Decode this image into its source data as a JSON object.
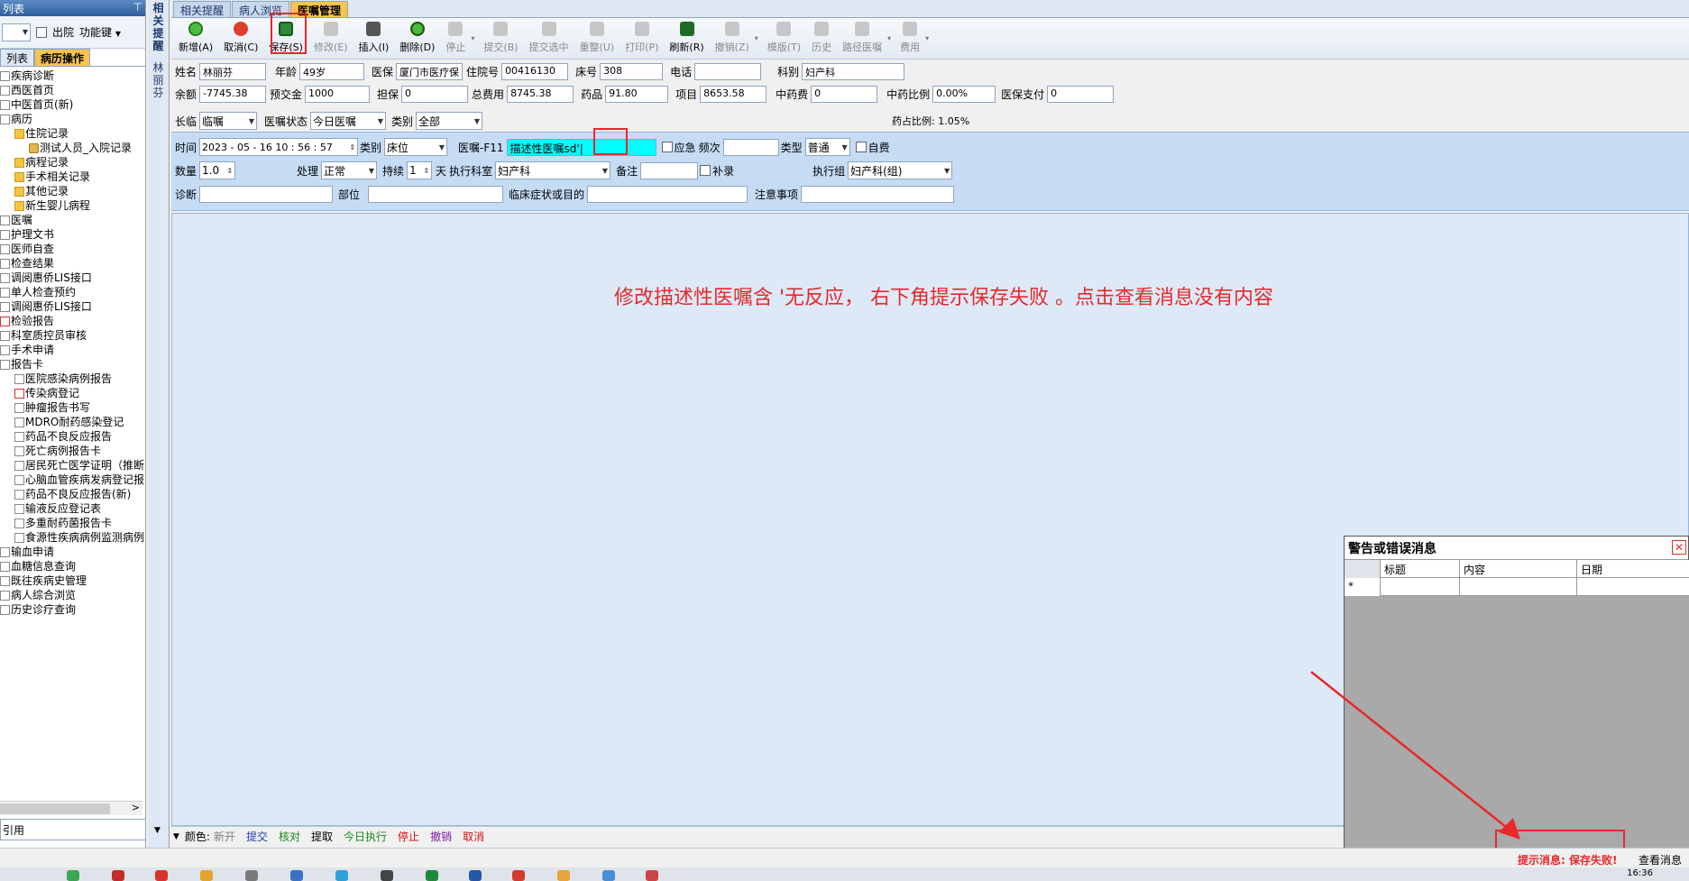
{
  "left": {
    "title": "列表",
    "pin": "⊤",
    "discharge_label": "出院",
    "function_key": "功能键",
    "tabs": [
      "列表",
      "病历操作"
    ],
    "tree": [
      {
        "label": "疾病诊断",
        "indent": 0,
        "icon": "doc"
      },
      {
        "label": "西医首页",
        "indent": 0,
        "icon": "doc"
      },
      {
        "label": "中医首页(新)",
        "indent": 0,
        "icon": "doc"
      },
      {
        "label": "病历",
        "indent": 0,
        "icon": "doc"
      },
      {
        "label": "住院记录",
        "indent": 1,
        "icon": "folder"
      },
      {
        "label": "测试人员_入院记录",
        "indent": 2,
        "icon": "lock"
      },
      {
        "label": "病程记录",
        "indent": 1,
        "icon": "folder"
      },
      {
        "label": "手术相关记录",
        "indent": 1,
        "icon": "folder"
      },
      {
        "label": "其他记录",
        "indent": 1,
        "icon": "folder"
      },
      {
        "label": "新生婴儿病程",
        "indent": 1,
        "icon": "folder"
      },
      {
        "label": "医嘱",
        "indent": 0,
        "icon": "doc"
      },
      {
        "label": "护理文书",
        "indent": 0,
        "icon": "doc"
      },
      {
        "label": "医师自查",
        "indent": 0,
        "icon": "doc"
      },
      {
        "label": "检查结果",
        "indent": 0,
        "icon": "doc"
      },
      {
        "label": "调阅惠侨LIS接口",
        "indent": 0,
        "icon": "doc"
      },
      {
        "label": "单人检查预约",
        "indent": 0,
        "icon": "doc"
      },
      {
        "label": "调阅惠侨LIS接口",
        "indent": 0,
        "icon": "doc"
      },
      {
        "label": "检验报告",
        "indent": 0,
        "icon": "red"
      },
      {
        "label": "科室质控员审核",
        "indent": 0,
        "icon": "doc"
      },
      {
        "label": "手术申请",
        "indent": 0,
        "icon": "doc"
      },
      {
        "label": "报告卡",
        "indent": 0,
        "icon": "doc"
      },
      {
        "label": "医院感染病例报告",
        "indent": 1,
        "icon": "doc"
      },
      {
        "label": "传染病登记",
        "indent": 1,
        "icon": "red"
      },
      {
        "label": "肿瘤报告书写",
        "indent": 1,
        "icon": "doc"
      },
      {
        "label": "MDRO耐药感染登记",
        "indent": 1,
        "icon": "doc"
      },
      {
        "label": "药品不良反应报告",
        "indent": 1,
        "icon": "doc"
      },
      {
        "label": "死亡病例报告卡",
        "indent": 1,
        "icon": "doc"
      },
      {
        "label": "居民死亡医学证明（推断",
        "indent": 1,
        "icon": "doc"
      },
      {
        "label": "心脑血管疾病发病登记报",
        "indent": 1,
        "icon": "doc"
      },
      {
        "label": "药品不良反应报告(新)",
        "indent": 1,
        "icon": "doc"
      },
      {
        "label": "输液反应登记表",
        "indent": 1,
        "icon": "doc"
      },
      {
        "label": "多重耐药菌报告卡",
        "indent": 1,
        "icon": "doc"
      },
      {
        "label": "食源性疾病病例监测病例",
        "indent": 1,
        "icon": "doc"
      },
      {
        "label": "输血申请",
        "indent": 0,
        "icon": "doc"
      },
      {
        "label": "血糖信息查询",
        "indent": 0,
        "icon": "doc"
      },
      {
        "label": "既往疾病史管理",
        "indent": 0,
        "icon": "doc"
      },
      {
        "label": "病人综合浏览",
        "indent": 0,
        "icon": "doc"
      },
      {
        "label": "历史诊疗查询",
        "indent": 0,
        "icon": "doc"
      }
    ],
    "bottom_text": "引用"
  },
  "vstrip": {
    "tab": [
      "相",
      "关",
      "提",
      "醒"
    ],
    "name": [
      "林",
      "丽",
      "芬"
    ]
  },
  "main": {
    "tabs": [
      "相关提醒",
      "病人浏览",
      "医嘱管理"
    ],
    "toolbar": [
      {
        "label": "新增(A)",
        "icon": "green",
        "enabled": true
      },
      {
        "label": "取消(C)",
        "icon": "undo",
        "enabled": true
      },
      {
        "label": "保存(S)",
        "icon": "save",
        "enabled": true
      },
      {
        "label": "修改(E)",
        "icon": "gray",
        "enabled": false
      },
      {
        "label": "插入(I)",
        "icon": "insert",
        "enabled": true
      },
      {
        "label": "删除(D)",
        "icon": "del",
        "enabled": true
      },
      {
        "label": "停止",
        "icon": "gray",
        "enabled": false,
        "drop": true
      },
      {
        "label": "提交(B)",
        "icon": "gray",
        "enabled": false
      },
      {
        "label": "提交选中",
        "icon": "gray",
        "enabled": false
      },
      {
        "label": "重整(U)",
        "icon": "gray",
        "enabled": false
      },
      {
        "label": "打印(P)",
        "icon": "gray",
        "enabled": false
      },
      {
        "label": "刷新(R)",
        "icon": "refresh",
        "enabled": true
      },
      {
        "label": "撤销(Z)",
        "icon": "gray",
        "enabled": false,
        "drop": true
      },
      {
        "label": "模版(T)",
        "icon": "gray",
        "enabled": false
      },
      {
        "label": "历史",
        "icon": "gray",
        "enabled": false
      },
      {
        "label": "路径医嘱",
        "icon": "gray",
        "enabled": false,
        "drop": true
      },
      {
        "label": "费用",
        "icon": "gray",
        "enabled": false,
        "drop": true
      }
    ],
    "patient": {
      "name_label": "姓名",
      "name": "林丽芬",
      "age_label": "年龄",
      "age": "49岁",
      "insurance_label": "医保",
      "insurance": "厦门市医疗保",
      "inpatient_no_label": "住院号",
      "inpatient_no": "00416130",
      "bed_label": "床号",
      "bed": "308",
      "phone_label": "电话",
      "phone": "",
      "dept_label": "科别",
      "dept": "妇产科",
      "balance_label": "余额",
      "balance": "-7745.38",
      "deposit_label": "预交金",
      "deposit": "1000",
      "guarantee_label": "担保",
      "guarantee": "0",
      "total_label": "总费用",
      "total": "8745.38",
      "drug_label": "药品",
      "drug": "91.80",
      "item_label": "项目",
      "item": "8653.58",
      "tcm_label": "中药费",
      "tcm": "0",
      "tcm_ratio_label": "中药比例",
      "tcm_ratio": "0.00%",
      "ins_pay_label": "医保支付",
      "ins_pay": "0"
    },
    "filter": {
      "type_label": "长临",
      "type_value": "临嘱",
      "status_label": "医嘱状态",
      "status_value": "今日医嘱",
      "category_label": "类别",
      "category_value": "全部",
      "drug_ratio": "药占比例: 1.05%"
    },
    "order": {
      "time_label": "时间",
      "time_value": "2023 - 05 - 16    10 : 56 : 57",
      "category_label": "类别",
      "category_value": "床位",
      "order_label": "医嘱-F11",
      "order_value": "描述性医嘱sd'|",
      "urgent_label": "应急",
      "freq_label": "频次",
      "freq_value": "",
      "kind_label": "类型",
      "kind_value": "普通",
      "selfpay_label": "自费",
      "qty_label": "数量",
      "qty_value": "1.0",
      "handle_label": "处理",
      "handle_value": "正常",
      "duration_label": "持续",
      "duration_value": "1",
      "day_label": "天",
      "exec_dept_label": "执行科室",
      "exec_dept_value": "妇产科",
      "remark_label": "备注",
      "remark_value": "",
      "supplement_label": "补录",
      "exec_group_label": "执行组",
      "exec_group_value": "妇产科(组)",
      "diag_label": "诊断",
      "diag_value": "",
      "site_label": "部位",
      "site_value": "",
      "symptom_label": "临床症状或目的",
      "symptom_value": "",
      "notes_label": "注意事项",
      "notes_value": ""
    },
    "annotation": "修改描述性医嘱含 '无反应， 右下角提示保存失败 。点击查看消息没有内容",
    "legend": {
      "label": "颜色:",
      "items": [
        {
          "text": "新开",
          "color": "#808080"
        },
        {
          "text": "提交",
          "color": "#1e3fa8"
        },
        {
          "text": "核对",
          "color": "#1a8a1a"
        },
        {
          "text": "提取",
          "color": "#000000"
        },
        {
          "text": "今日执行",
          "color": "#1a8a1a"
        },
        {
          "text": "停止",
          "color": "#d01010"
        },
        {
          "text": "撤销",
          "color": "#7a1fa8"
        },
        {
          "text": "取消",
          "color": "#d01010"
        }
      ]
    }
  },
  "warning": {
    "title": "警告或错误消息",
    "columns": [
      "标题",
      "内容",
      "日期"
    ],
    "new_row_marker": "*"
  },
  "status": {
    "message": "提示消息: 保存失败!",
    "view_messages": "查看消息>"
  },
  "taskbar": {
    "clock": "16:36"
  }
}
